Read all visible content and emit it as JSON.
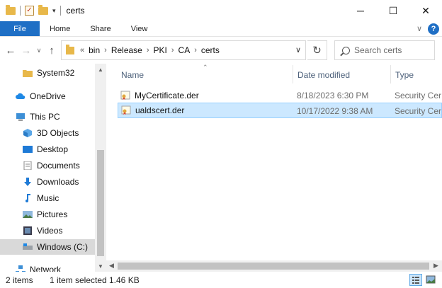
{
  "window": {
    "title": "certs",
    "controls": {
      "minimize": "─",
      "maximize": "☐",
      "close": "✕"
    }
  },
  "ribbon": {
    "file": "File",
    "tabs": [
      "Home",
      "Share",
      "View"
    ],
    "collapse_glyph": "∨",
    "help_glyph": "?"
  },
  "nav": {
    "back": "←",
    "forward": "→",
    "recent": "∨",
    "up": "↑",
    "overflow": "«",
    "breadcrumbs": [
      "bin",
      "Release",
      "PKI",
      "CA",
      "certs"
    ],
    "crumb_separator": "›",
    "dropdown": "∨",
    "refresh": "↻"
  },
  "search": {
    "placeholder": "Search certs"
  },
  "sidebar": {
    "items": [
      {
        "label": "System32",
        "icon": "folder-icon",
        "selected": false
      },
      {
        "label": "OneDrive",
        "icon": "cloud-icon",
        "selected": false
      },
      {
        "label": "This PC",
        "icon": "computer-icon",
        "selected": false
      },
      {
        "label": "3D Objects",
        "icon": "cube-icon",
        "selected": false
      },
      {
        "label": "Desktop",
        "icon": "desktop-icon",
        "selected": false
      },
      {
        "label": "Documents",
        "icon": "document-icon",
        "selected": false
      },
      {
        "label": "Downloads",
        "icon": "download-icon",
        "selected": false
      },
      {
        "label": "Music",
        "icon": "music-icon",
        "selected": false
      },
      {
        "label": "Pictures",
        "icon": "pictures-icon",
        "selected": false
      },
      {
        "label": "Videos",
        "icon": "videos-icon",
        "selected": false
      },
      {
        "label": "Windows (C:)",
        "icon": "drive-icon",
        "selected": true
      },
      {
        "label": "Network",
        "icon": "network-icon",
        "selected": false
      }
    ]
  },
  "filelist": {
    "columns": [
      "Name",
      "Date modified",
      "Type"
    ],
    "rows": [
      {
        "name": "MyCertificate.der",
        "date": "8/18/2023 6:30 PM",
        "type": "Security Certificate",
        "selected": false
      },
      {
        "name": "ualdscert.der",
        "date": "10/17/2022 9:38 AM",
        "type": "Security Certificate",
        "selected": true
      }
    ]
  },
  "status": {
    "items": "2 items",
    "selected": "1 item selected",
    "size": "1.46 KB"
  },
  "colors": {
    "accent": "#1f6fc5",
    "selection": "#cce8ff",
    "folder": "#e8b84a"
  }
}
